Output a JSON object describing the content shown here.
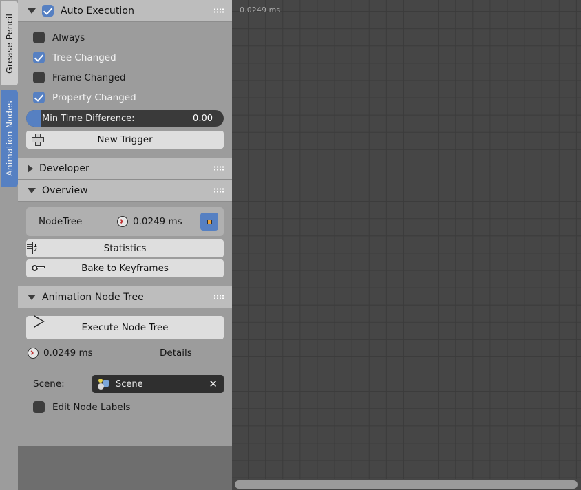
{
  "editor": {
    "stat_overlay": "0.0249 ms"
  },
  "tabs": [
    {
      "label": "Grease Pencil",
      "active": false
    },
    {
      "label": "Animation Nodes",
      "active": true
    }
  ],
  "panels": {
    "auto_execution": {
      "title": "Auto Execution",
      "enabled": true,
      "options": [
        {
          "label": "Always",
          "checked": false
        },
        {
          "label": "Tree Changed",
          "checked": true
        },
        {
          "label": "Frame Changed",
          "checked": false
        },
        {
          "label": "Property Changed",
          "checked": true
        }
      ],
      "slider": {
        "label": "Min Time Difference:",
        "value": "0.00"
      },
      "new_trigger_label": "New Trigger"
    },
    "developer": {
      "title": "Developer",
      "expanded": false
    },
    "overview": {
      "title": "Overview",
      "expanded": true,
      "node_tree_row": {
        "name": "NodeTree",
        "time": "0.0249 ms"
      },
      "statistics_label": "Statistics",
      "bake_label": "Bake to Keyframes"
    },
    "animation_node_tree": {
      "title": "Animation Node Tree",
      "expanded": true,
      "execute_label": "Execute Node Tree",
      "time": "0.0249 ms",
      "details_label": "Details",
      "scene_label": "Scene:",
      "scene_value": "Scene",
      "edit_node_labels": {
        "label": "Edit Node Labels",
        "checked": false
      }
    }
  },
  "colors": {
    "accent_blue": "#5680c2",
    "panel_header": "#bdbdbd",
    "panel_body": "#9c9c9c",
    "grid_bg": "#464646",
    "button": "#dedede",
    "orange_dot": "#e8a13c"
  }
}
